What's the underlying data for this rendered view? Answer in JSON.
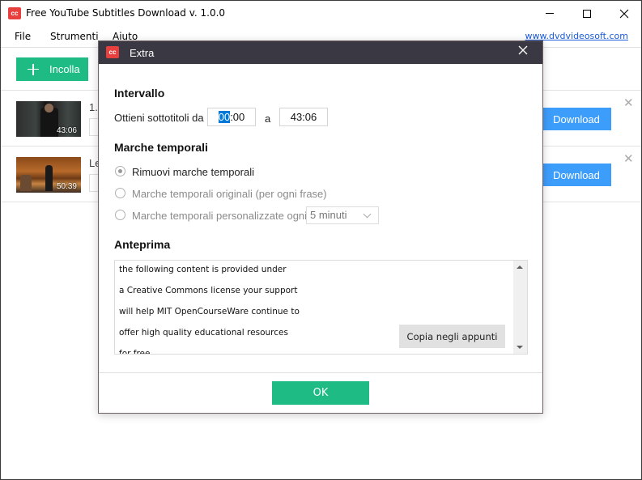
{
  "window": {
    "title": "Free YouTube Subtitles Download v. 1.0.0",
    "icon_label": "cc"
  },
  "menu": {
    "items": [
      "File",
      "Strumenti",
      "Aiuto"
    ],
    "site_link": "www.dvdvideosoft.com"
  },
  "toolbar": {
    "paste_label": "Incolla"
  },
  "videos": [
    {
      "title": "1.",
      "duration": "43:06",
      "download_label": "Download"
    },
    {
      "title": "Le",
      "duration": "50:39",
      "download_label": "Download"
    }
  ],
  "dialog": {
    "title": "Extra",
    "icon_label": "cc",
    "interval": {
      "heading": "Intervallo",
      "from_label": "Ottieni sottotitoli da",
      "from_selected": "00",
      "from_rest": ":00",
      "to_label": "a",
      "to_value": "43:06"
    },
    "timestamps": {
      "heading": "Marche temporali",
      "options": [
        {
          "label": "Rimuovi marche temporali",
          "checked": true
        },
        {
          "label": "Marche temporali originali (per ogni frase)",
          "checked": false
        },
        {
          "label": "Marche temporali personalizzate ogni",
          "checked": false
        }
      ],
      "interval_select": "5 minuti"
    },
    "preview": {
      "heading": "Anteprima",
      "lines": [
        "the following content is provided under",
        "a Creative Commons license your support",
        "will help MIT OpenCourseWare continue to",
        "offer high quality educational resources",
        "for free"
      ],
      "copy_label": "Copia negli appunti"
    },
    "ok_label": "OK"
  },
  "colors": {
    "accent_green": "#1fbb84",
    "download_blue": "#3d9dfb",
    "brand_red": "#e8403f",
    "dialog_titlebar": "#3a3842"
  }
}
